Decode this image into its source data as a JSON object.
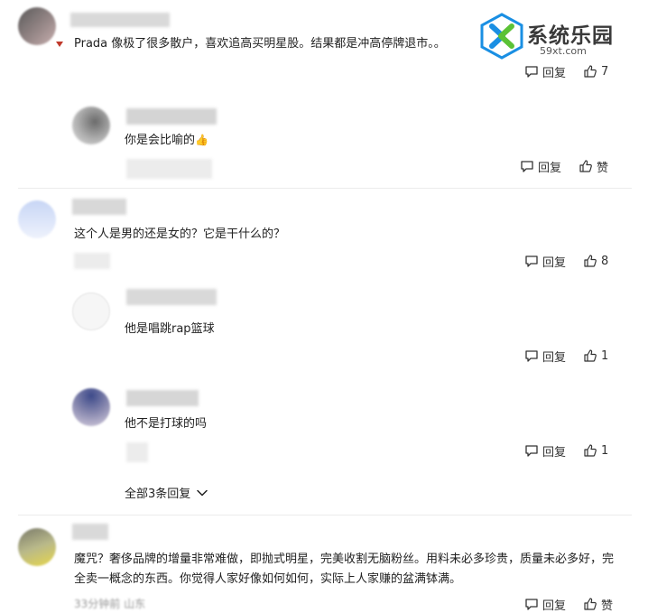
{
  "watermark": {
    "site_name": "系统乐园",
    "site_url": "59xt.com"
  },
  "comments": [
    {
      "text": "Prada 像极了很多散户，喜欢追高买明星股。结果都是冲高停牌退市。。",
      "reply_label": "回复",
      "like_label": "7",
      "replies": [
        {
          "text": "你是会比喻的",
          "emoji": "👍",
          "reply_label": "回复",
          "like_label": "赞"
        }
      ]
    },
    {
      "text": "这个人是男的还是女的？它是干什么的？",
      "reply_label": "回复",
      "like_label": "8",
      "replies": [
        {
          "text": "他是唱跳rap篮球",
          "reply_label": "回复",
          "like_label": "1"
        },
        {
          "text": "他不是打球的吗",
          "reply_label": "回复",
          "like_label": "1"
        }
      ],
      "more_replies_label": "全部3条回复"
    },
    {
      "text": "魔咒？奢侈品牌的增量非常难做，即抛式明星，完美收割无脑粉丝。用料未必多珍贵，质量未必多好，完全卖一概念的东西。你觉得人家好像如何如何，实际上人家赚的盆满钵满。",
      "meta_partial": "33分钟前 山东",
      "reply_label": "回复",
      "like_label": "赞"
    }
  ],
  "colors": {
    "text": "#222222",
    "action": "#333333",
    "logo_blue": "#1a8fe3",
    "logo_green": "#5bc236"
  }
}
